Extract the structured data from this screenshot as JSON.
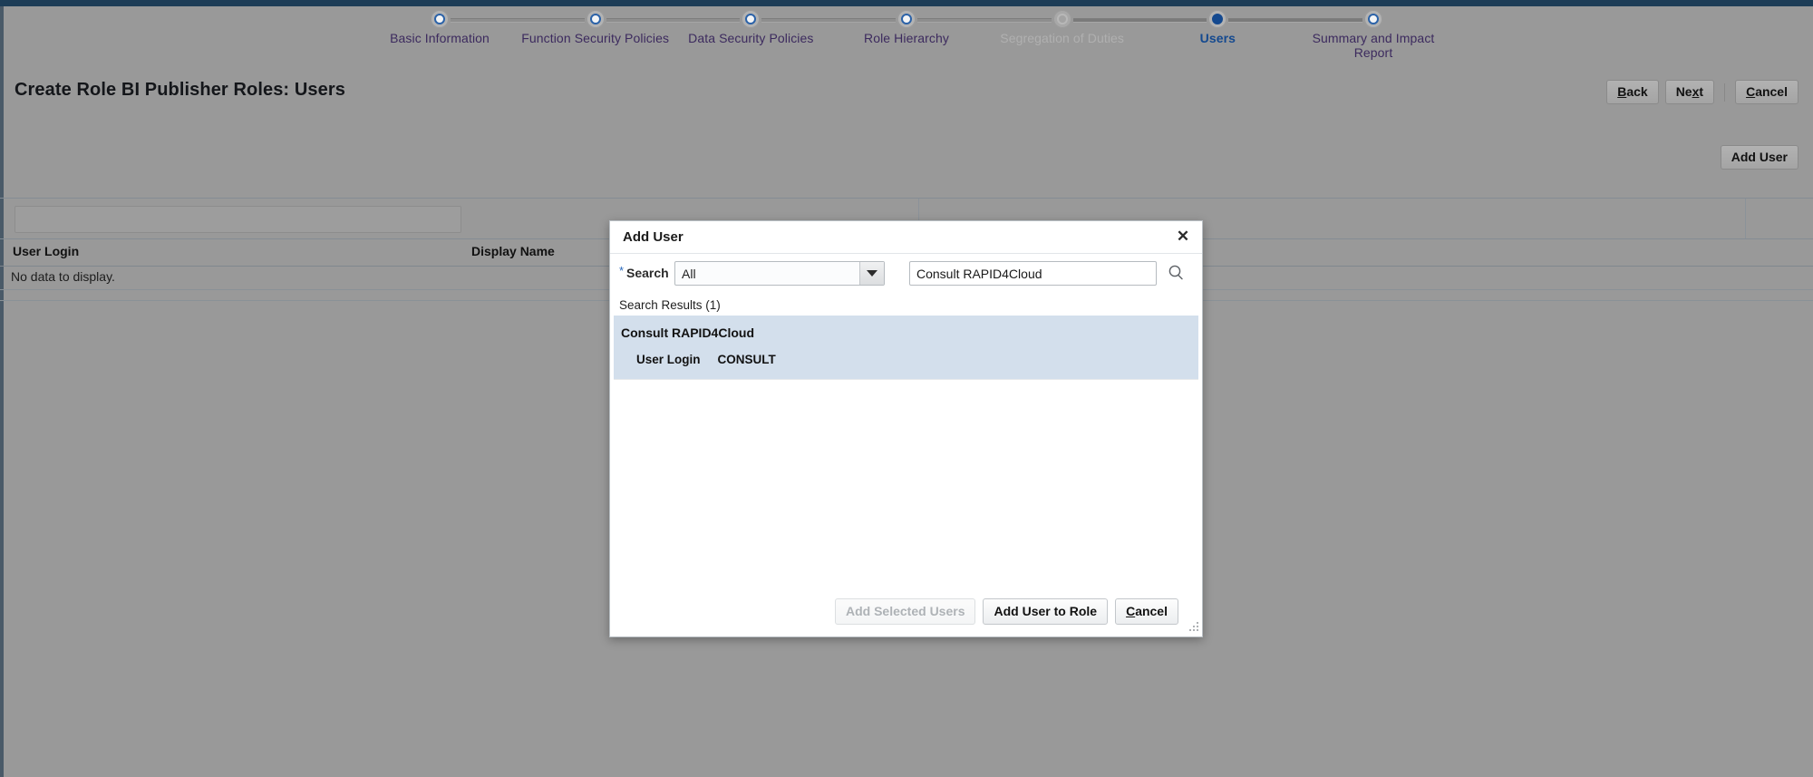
{
  "window": {
    "top_bar_color": "#1d3d57",
    "overlay_color": "#999999"
  },
  "train": {
    "steps": [
      {
        "label": "Basic Information",
        "state": "visited"
      },
      {
        "label": "Function Security Policies",
        "state": "visited"
      },
      {
        "label": "Data Security Policies",
        "state": "visited"
      },
      {
        "label": "Role Hierarchy",
        "state": "visited"
      },
      {
        "label": "Segregation of Duties",
        "state": "disabled"
      },
      {
        "label": "Users",
        "state": "current"
      },
      {
        "label": "Summary and Impact Report",
        "state": "visited"
      }
    ]
  },
  "header": {
    "title": "Create Role BI Publisher Roles: Users",
    "buttons": [
      {
        "label": "Back",
        "accesskey": "B"
      },
      {
        "label": "Next",
        "accesskey": "x"
      },
      {
        "label": "Cancel",
        "accesskey": "C"
      }
    ]
  },
  "toolbar": {
    "add_user_label": "Add User"
  },
  "users_table": {
    "filter_value": "",
    "columns": [
      "User Login",
      "Display Name"
    ],
    "empty_text": "No data to display."
  },
  "dialog": {
    "title": "Add User",
    "close_icon": "close-icon",
    "search": {
      "required_marker": "*",
      "label": "Search",
      "select_value": "All",
      "select_options": [
        "All"
      ],
      "text_value": "Consult RAPID4Cloud",
      "text_placeholder": "",
      "go_icon": "search-icon"
    },
    "results_label": "Search Results (1)",
    "results": [
      {
        "name": "Consult RAPID4Cloud",
        "detail_label": "User Login",
        "detail_value": "CONSULT",
        "selected": true
      }
    ],
    "footer_buttons": [
      {
        "label": "Add Selected Users",
        "state": "disabled"
      },
      {
        "label": "Add User to Role",
        "state": "enabled"
      },
      {
        "label": "Cancel",
        "state": "enabled",
        "accesskey": "C"
      }
    ]
  }
}
